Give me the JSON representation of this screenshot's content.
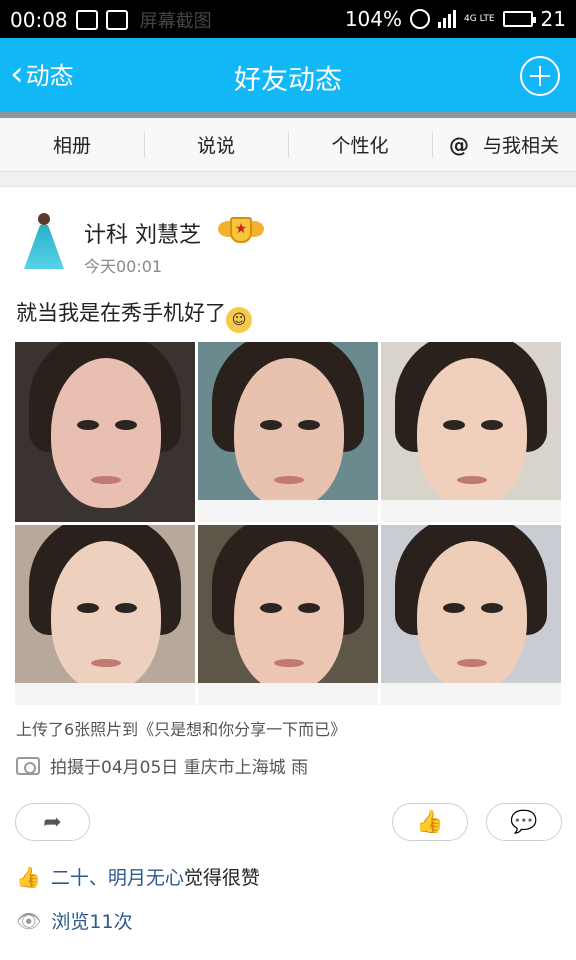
{
  "status_bar": {
    "time": "00:08",
    "ghost_text": "屏幕截图",
    "battery_text": "104%",
    "network": "4G LTE",
    "right_number": "21"
  },
  "nav": {
    "back_label": "动态",
    "title": "好友动态"
  },
  "tabs": [
    {
      "label": "相册"
    },
    {
      "label": "说说"
    },
    {
      "label": "个性化"
    },
    {
      "label": "与我相关",
      "prefix": "@"
    }
  ],
  "post": {
    "author": "计科 刘慧芝",
    "time": "今天00:01",
    "text": "就当我是在秀手机好了",
    "emoji": "😂",
    "photo_count": 6,
    "upload_caption": "上传了6张照片到《只是想和你分享一下而已》",
    "location": "拍摄于04月05日 重庆市上海城 雨",
    "likes": {
      "names": "二十、明月无心",
      "suffix": "觉得很赞"
    },
    "views": "浏览11次"
  },
  "icons": {
    "back": "chevron-left-icon",
    "add": "plus-circle-icon",
    "share": "share-arrow-icon",
    "like": "thumbs-up-icon",
    "comment": "comment-bubble-icon",
    "camera": "camera-icon",
    "views": "eye-icon"
  },
  "colors": {
    "nav_bg": "#12b7f5",
    "link": "#2d5a8e"
  }
}
